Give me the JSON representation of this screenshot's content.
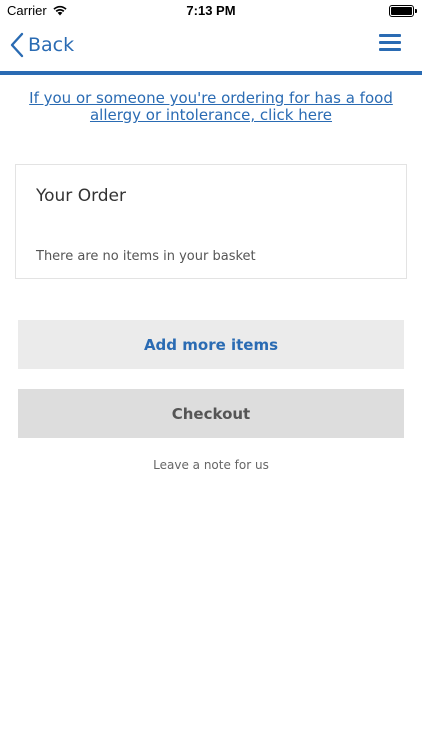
{
  "status_bar": {
    "carrier": "Carrier",
    "time": "7:13 PM"
  },
  "nav": {
    "back_label": "Back",
    "menu_icon": "hamburger-menu-icon"
  },
  "allergy_notice": {
    "text": "If you or someone you're ordering for has a food allergy or intolerance, click here"
  },
  "order": {
    "title": "Your Order",
    "empty_message": "There are no items in your basket"
  },
  "actions": {
    "add_items_label": "Add more items",
    "checkout_label": "Checkout",
    "note_label": "Leave a note for us"
  },
  "colors": {
    "accent": "#2a6bb3",
    "button_light": "#ebebeb",
    "button_dark": "#dddddd"
  }
}
